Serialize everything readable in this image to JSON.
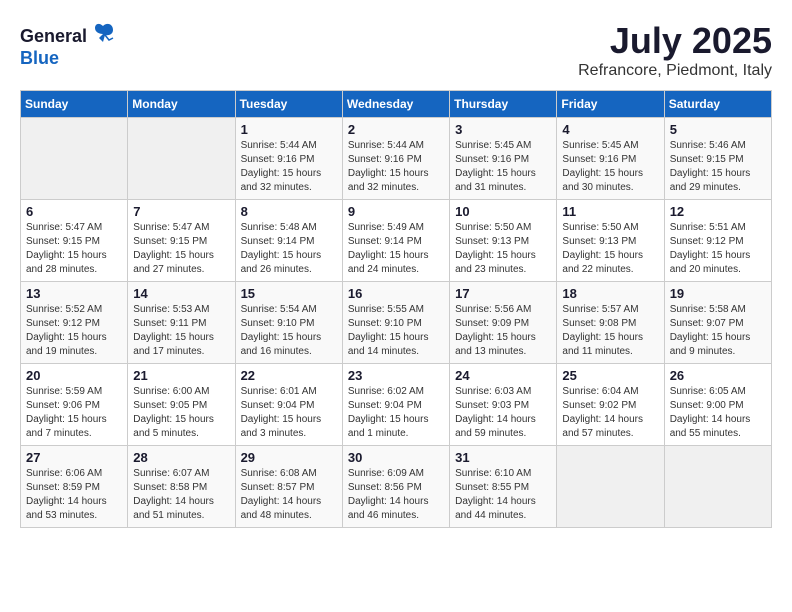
{
  "logo": {
    "general": "General",
    "blue": "Blue"
  },
  "header": {
    "month": "July 2025",
    "location": "Refrancore, Piedmont, Italy"
  },
  "weekdays": [
    "Sunday",
    "Monday",
    "Tuesday",
    "Wednesday",
    "Thursday",
    "Friday",
    "Saturday"
  ],
  "weeks": [
    [
      {
        "day": "",
        "empty": true
      },
      {
        "day": "",
        "empty": true
      },
      {
        "day": "1",
        "sunrise": "5:44 AM",
        "sunset": "9:16 PM",
        "daylight": "15 hours and 32 minutes."
      },
      {
        "day": "2",
        "sunrise": "5:44 AM",
        "sunset": "9:16 PM",
        "daylight": "15 hours and 32 minutes."
      },
      {
        "day": "3",
        "sunrise": "5:45 AM",
        "sunset": "9:16 PM",
        "daylight": "15 hours and 31 minutes."
      },
      {
        "day": "4",
        "sunrise": "5:45 AM",
        "sunset": "9:16 PM",
        "daylight": "15 hours and 30 minutes."
      },
      {
        "day": "5",
        "sunrise": "5:46 AM",
        "sunset": "9:15 PM",
        "daylight": "15 hours and 29 minutes."
      }
    ],
    [
      {
        "day": "6",
        "sunrise": "5:47 AM",
        "sunset": "9:15 PM",
        "daylight": "15 hours and 28 minutes."
      },
      {
        "day": "7",
        "sunrise": "5:47 AM",
        "sunset": "9:15 PM",
        "daylight": "15 hours and 27 minutes."
      },
      {
        "day": "8",
        "sunrise": "5:48 AM",
        "sunset": "9:14 PM",
        "daylight": "15 hours and 26 minutes."
      },
      {
        "day": "9",
        "sunrise": "5:49 AM",
        "sunset": "9:14 PM",
        "daylight": "15 hours and 24 minutes."
      },
      {
        "day": "10",
        "sunrise": "5:50 AM",
        "sunset": "9:13 PM",
        "daylight": "15 hours and 23 minutes."
      },
      {
        "day": "11",
        "sunrise": "5:50 AM",
        "sunset": "9:13 PM",
        "daylight": "15 hours and 22 minutes."
      },
      {
        "day": "12",
        "sunrise": "5:51 AM",
        "sunset": "9:12 PM",
        "daylight": "15 hours and 20 minutes."
      }
    ],
    [
      {
        "day": "13",
        "sunrise": "5:52 AM",
        "sunset": "9:12 PM",
        "daylight": "15 hours and 19 minutes."
      },
      {
        "day": "14",
        "sunrise": "5:53 AM",
        "sunset": "9:11 PM",
        "daylight": "15 hours and 17 minutes."
      },
      {
        "day": "15",
        "sunrise": "5:54 AM",
        "sunset": "9:10 PM",
        "daylight": "15 hours and 16 minutes."
      },
      {
        "day": "16",
        "sunrise": "5:55 AM",
        "sunset": "9:10 PM",
        "daylight": "15 hours and 14 minutes."
      },
      {
        "day": "17",
        "sunrise": "5:56 AM",
        "sunset": "9:09 PM",
        "daylight": "15 hours and 13 minutes."
      },
      {
        "day": "18",
        "sunrise": "5:57 AM",
        "sunset": "9:08 PM",
        "daylight": "15 hours and 11 minutes."
      },
      {
        "day": "19",
        "sunrise": "5:58 AM",
        "sunset": "9:07 PM",
        "daylight": "15 hours and 9 minutes."
      }
    ],
    [
      {
        "day": "20",
        "sunrise": "5:59 AM",
        "sunset": "9:06 PM",
        "daylight": "15 hours and 7 minutes."
      },
      {
        "day": "21",
        "sunrise": "6:00 AM",
        "sunset": "9:05 PM",
        "daylight": "15 hours and 5 minutes."
      },
      {
        "day": "22",
        "sunrise": "6:01 AM",
        "sunset": "9:04 PM",
        "daylight": "15 hours and 3 minutes."
      },
      {
        "day": "23",
        "sunrise": "6:02 AM",
        "sunset": "9:04 PM",
        "daylight": "15 hours and 1 minute."
      },
      {
        "day": "24",
        "sunrise": "6:03 AM",
        "sunset": "9:03 PM",
        "daylight": "14 hours and 59 minutes."
      },
      {
        "day": "25",
        "sunrise": "6:04 AM",
        "sunset": "9:02 PM",
        "daylight": "14 hours and 57 minutes."
      },
      {
        "day": "26",
        "sunrise": "6:05 AM",
        "sunset": "9:00 PM",
        "daylight": "14 hours and 55 minutes."
      }
    ],
    [
      {
        "day": "27",
        "sunrise": "6:06 AM",
        "sunset": "8:59 PM",
        "daylight": "14 hours and 53 minutes."
      },
      {
        "day": "28",
        "sunrise": "6:07 AM",
        "sunset": "8:58 PM",
        "daylight": "14 hours and 51 minutes."
      },
      {
        "day": "29",
        "sunrise": "6:08 AM",
        "sunset": "8:57 PM",
        "daylight": "14 hours and 48 minutes."
      },
      {
        "day": "30",
        "sunrise": "6:09 AM",
        "sunset": "8:56 PM",
        "daylight": "14 hours and 46 minutes."
      },
      {
        "day": "31",
        "sunrise": "6:10 AM",
        "sunset": "8:55 PM",
        "daylight": "14 hours and 44 minutes."
      },
      {
        "day": "",
        "empty": true
      },
      {
        "day": "",
        "empty": true
      }
    ]
  ]
}
